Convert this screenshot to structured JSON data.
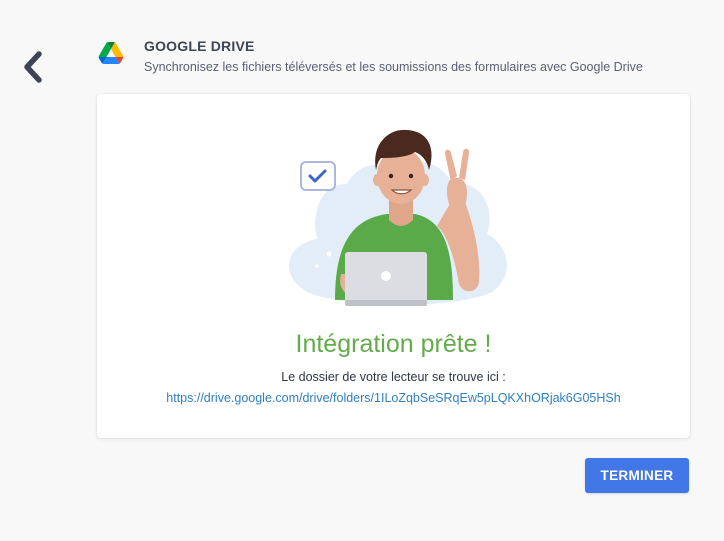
{
  "header": {
    "title": "GOOGLE DRIVE",
    "subtitle": "Synchronisez les fichiers téléversés et les soumissions des formulaires avec Google Drive"
  },
  "card": {
    "success_title": "Intégration prête !",
    "folder_label": "Le dossier de votre lecteur se trouve ici :",
    "folder_link": "https://drive.google.com/drive/folders/1ILoZqbSeSRqEw5pLQKXhORjak6G05HSh"
  },
  "actions": {
    "finish_label": "TERMINER"
  },
  "icons": {
    "back": "chevron-left-icon",
    "brand": "google-drive-icon",
    "illustration": "person-with-laptop-illustration"
  },
  "colors": {
    "accent": "#4277e8",
    "success": "#64ac4b",
    "link": "#2f80c0"
  }
}
